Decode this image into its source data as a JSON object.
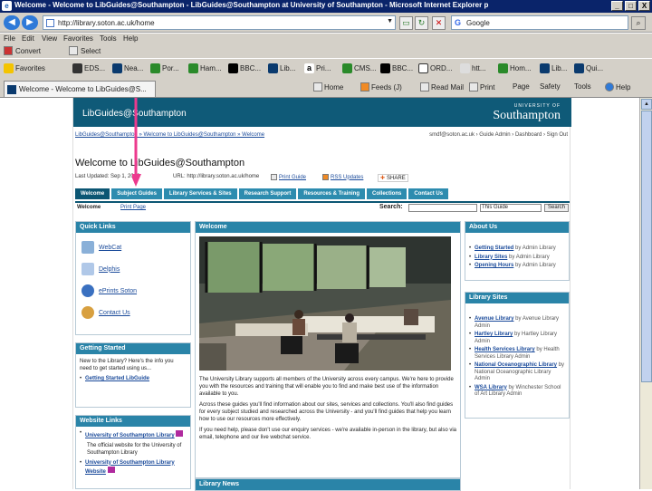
{
  "window": {
    "title": "Welcome - Welcome to LibGuides@Southampton - LibGuides@Southampton at University of Southampton - Microsoft Internet Explorer p",
    "controls": [
      "_",
      "□",
      "X"
    ]
  },
  "address_bar": {
    "url": "http://library.soton.ac.uk/home",
    "search_value": "Google"
  },
  "menu": [
    "File",
    "Edit",
    "View",
    "Favorites",
    "Tools",
    "Help"
  ],
  "command_bar": {
    "convert": "Convert",
    "select": "Select"
  },
  "favorites_bar": {
    "favorites_label": "Favorites",
    "items": [
      "EDS...",
      "Nea...",
      "Por...",
      "Ham...",
      "BBC...",
      "Lib...",
      "Pri...",
      "CMS...",
      "BBC...",
      "ORD...",
      "htt...",
      "Hom...",
      "Lib...",
      "Qui..."
    ]
  },
  "tab": {
    "title": "Welcome - Welcome to LibGuides@S..."
  },
  "tools": {
    "home": "Home",
    "feeds": "Feeds (J)",
    "read_mail": "Read Mail",
    "print": "Print",
    "page": "Page",
    "safety": "Safety",
    "tools": "Tools",
    "help": "Help"
  },
  "site": {
    "brand": "LibGuides@Southampton",
    "university_small": "UNIVERSITY OF",
    "university_big": "Southampton",
    "breadcrumb": "LibGuides@Southampton » Welcome to LibGuides@Southampton » Welcome",
    "user_links": "smdf@soton.ac.uk  ›  Guide Admin  ›  Dashboard  ›  Sign Out",
    "guide_title": "Welcome to LibGuides@Southampton",
    "last_updated": "Last Updated: Sep 1, 2010",
    "guide_url": "URL: http://library.soton.ac.uk/home",
    "print_guide": "Print Guide",
    "rss_updates": "RSS Updates",
    "share": "SHARE",
    "tabs": [
      "Welcome",
      "Subject Guides",
      "Library Services & Sites",
      "Research Support",
      "Resources & Training",
      "Collections",
      "Contact Us"
    ],
    "sub_welcome": "Welcome",
    "print_page": "Print Page",
    "search_label": "Search:",
    "search_scope": "This Guide",
    "search_button": "Search"
  },
  "quick_links": {
    "title": "Quick Links",
    "items": [
      "WebCat",
      "Delphis",
      "ePrints Soton",
      "Contact Us"
    ]
  },
  "getting_started": {
    "title": "Getting Started",
    "text": "New to the Library? Here's the info you need to get started using us...",
    "link": "Getting Started LibGuide"
  },
  "website_links": {
    "title": "Website Links",
    "link1": "University of Southampton Library",
    "desc1": "The official website for the University of Southampton Library",
    "link2": "University of Southampton Library Website"
  },
  "welcome": {
    "title": "Welcome",
    "p1": "The University Library supports all members of the University across every campus. We're here to provide you with the resources and training that will enable you to find and make best use of the information available to you.",
    "p2": "Across these guides you'll find information about our sites, services and collections. You'll also find guides for every subject studied and researched across the University - and you'll find guides that help you learn how to use our resources more effectively.",
    "p3": "If you need help, please don't use our enquiry services - we're available in-person in the library, but also via email, telephone and our live webchat service."
  },
  "library_news": {
    "title": "Library News"
  },
  "about_us": {
    "title": "About Us",
    "items": [
      {
        "link": "Getting Started",
        "by": "by Admin Library"
      },
      {
        "link": "Library Sites",
        "by": "by Admin Library"
      },
      {
        "link": "Opening Hours",
        "by": "by Admin Library"
      }
    ]
  },
  "library_sites": {
    "title": "Library Sites",
    "items": [
      {
        "link": "Avenue Library",
        "by": "by Avenue Library Admin"
      },
      {
        "link": "Hartley Library",
        "by": "by Hartley Library Admin"
      },
      {
        "link": "Health Services Library",
        "by": "by Health Services Library Admin"
      },
      {
        "link": "National Oceanographic Library",
        "by": "by National Oceanographic Library Admin"
      },
      {
        "link": "WSA Library",
        "by": "by Winchester School of Art Library Admin"
      }
    ]
  }
}
